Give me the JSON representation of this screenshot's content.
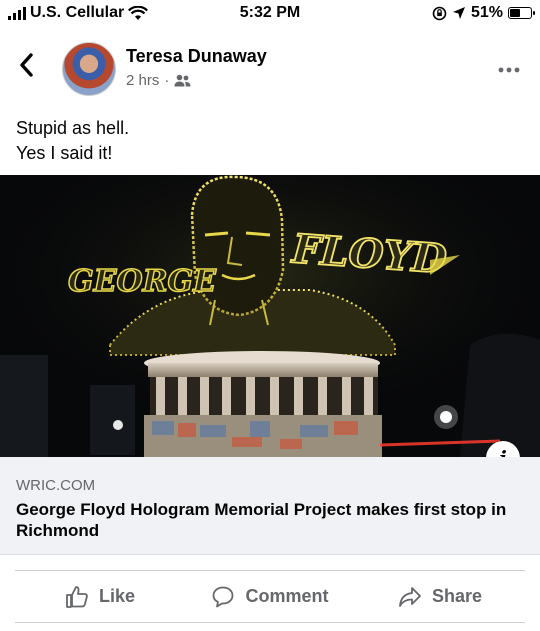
{
  "status_bar": {
    "carrier": "U.S. Cellular",
    "time": "5:32 PM",
    "battery": "51%",
    "battery_level": 0.51
  },
  "post": {
    "author": "Teresa Dunaway",
    "time_ago": "2 hrs",
    "separator": "·",
    "audience_icon": "friends-icon",
    "text_lines": [
      "Stupid as hell.",
      "Yes I said it!"
    ]
  },
  "media": {
    "overlay_words": [
      "GEORGE",
      "FLOYD"
    ]
  },
  "link_card": {
    "domain": "WRIC.COM",
    "headline": "George Floyd Hologram Memorial Project makes first stop in Richmond"
  },
  "actions": {
    "like": "Like",
    "comment": "Comment",
    "share": "Share"
  },
  "colors": {
    "secondary_text": "#65676b",
    "card_bg": "#f0f2f5",
    "hologram": "#e8d84a"
  }
}
